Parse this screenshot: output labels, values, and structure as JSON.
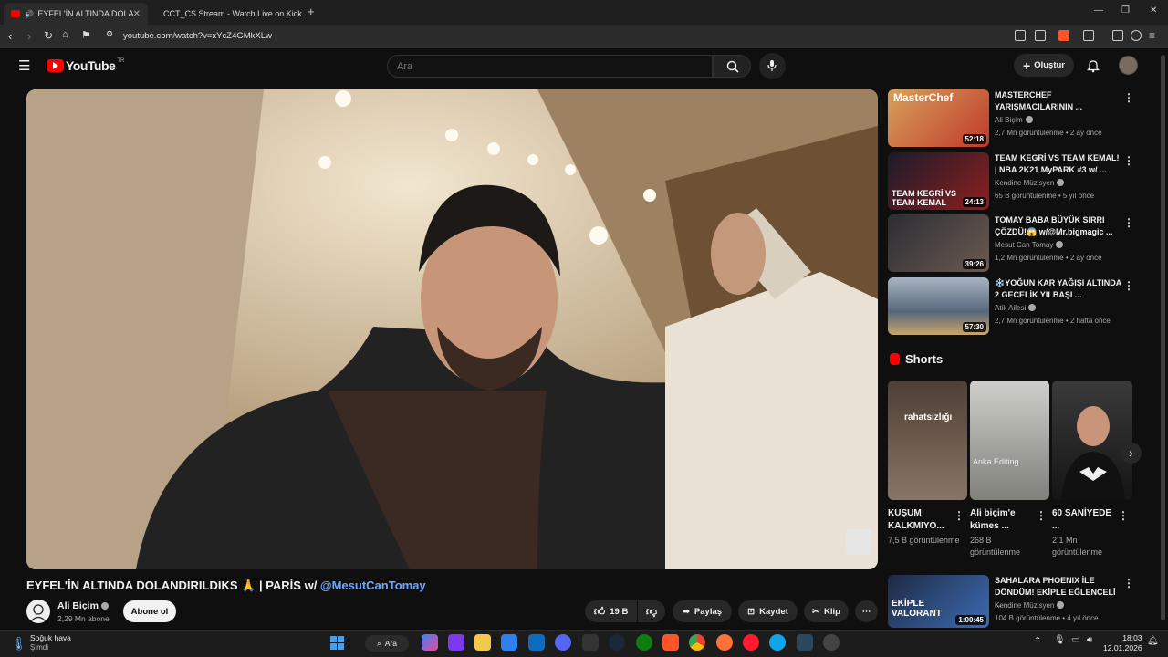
{
  "browser": {
    "tabs": [
      {
        "label": "EYFEL'İN ALTINDA DOLANDI",
        "active": true
      },
      {
        "label": "CCT_CS Stream - Watch Live on Kick",
        "active": false
      }
    ],
    "url": "youtube.com/watch?v=xYcZ4GMkXLw"
  },
  "header": {
    "logo_text": "YouTube",
    "logo_region": "TR",
    "search_placeholder": "Ara",
    "create_label": "Oluştur"
  },
  "video": {
    "title_main": "EYFEL'İN ALTINDA DOLANDIRILDIKS 🙏 | PARİS w/ ",
    "title_mention": "@MesutCanTomay",
    "channel_name": "Ali Biçim",
    "subscribers": "2,29 Mn abone",
    "subscribe_label": "Abone ol",
    "likes": "19 B",
    "share_label": "Paylaş",
    "save_label": "Kaydet",
    "clip_label": "Klip"
  },
  "recommendations": [
    {
      "title": "MASTERCHEF YARIŞMACILARININ ...",
      "channel": "Ali Biçim",
      "meta": "2,7 Mn görüntülenme • 2 ay önce",
      "duration": "52:18",
      "thumb_text": "MasterChef",
      "color": "#c0392b"
    },
    {
      "title": "TEAM KEGRİ VS TEAM KEMAL! | NBA 2K21 MyPARK #3 w/ ...",
      "channel": "Kendine Müzisyen",
      "meta": "65 B görüntülenme • 5 yıl önce",
      "duration": "24:13",
      "thumb_text": "TEAM KEGRİ VS TEAM KEMAL",
      "color": "#8e1f1f"
    },
    {
      "title": "TOMAY BABA BÜYÜK SIRRI ÇÖZDÜ!😱 w/@Mr.bigmagic ...",
      "channel": "Mesut Can Tomay",
      "meta": "1,2 Mn görüntülenme • 2 ay önce",
      "duration": "39:26",
      "thumb_text": "",
      "color": "#2d2d35"
    },
    {
      "title": "❄️YOĞUN KAR YAĞIŞI ALTINDA 2 GECELİK YILBAŞI ...",
      "channel": "Atik Ailesi",
      "meta": "2,7 Mn görüntülenme • 2 hafta önce",
      "duration": "57:30",
      "thumb_text": "",
      "color": "#56677a"
    },
    {
      "title": "SAHALARA PHOENIX İLE DÖNDÜM! EKİPLE EĞLENCELİ ...",
      "channel": "Kendine Müzisyen",
      "meta": "104 B görüntülenme • 4 yıl önce",
      "duration": "1:00:45",
      "thumb_text": "EKİPLE VALORANT",
      "color": "#1e2a44"
    }
  ],
  "shorts": {
    "section_title": "Shorts",
    "items": [
      {
        "title": "KUŞUM KALKMIYO...",
        "views": "7,5 B görüntülenme",
        "overlay": "rahatsızlığı",
        "color": "#6d5a4c"
      },
      {
        "title": "Ali biçim'e kümes ...",
        "views": "268 B görüntülenme",
        "overlay": "Anka Editing",
        "color": "#9a9b95"
      },
      {
        "title": "60 SANİYEDE ...",
        "views": "2,1 Mn görüntülenme",
        "overlay": "",
        "color": "#2a2a2a"
      }
    ]
  },
  "taskbar": {
    "weather_title": "Soğuk hava",
    "weather_sub": "Şimdi",
    "search_label": "Ara",
    "time": "18:03",
    "date": "12.01.2026"
  }
}
